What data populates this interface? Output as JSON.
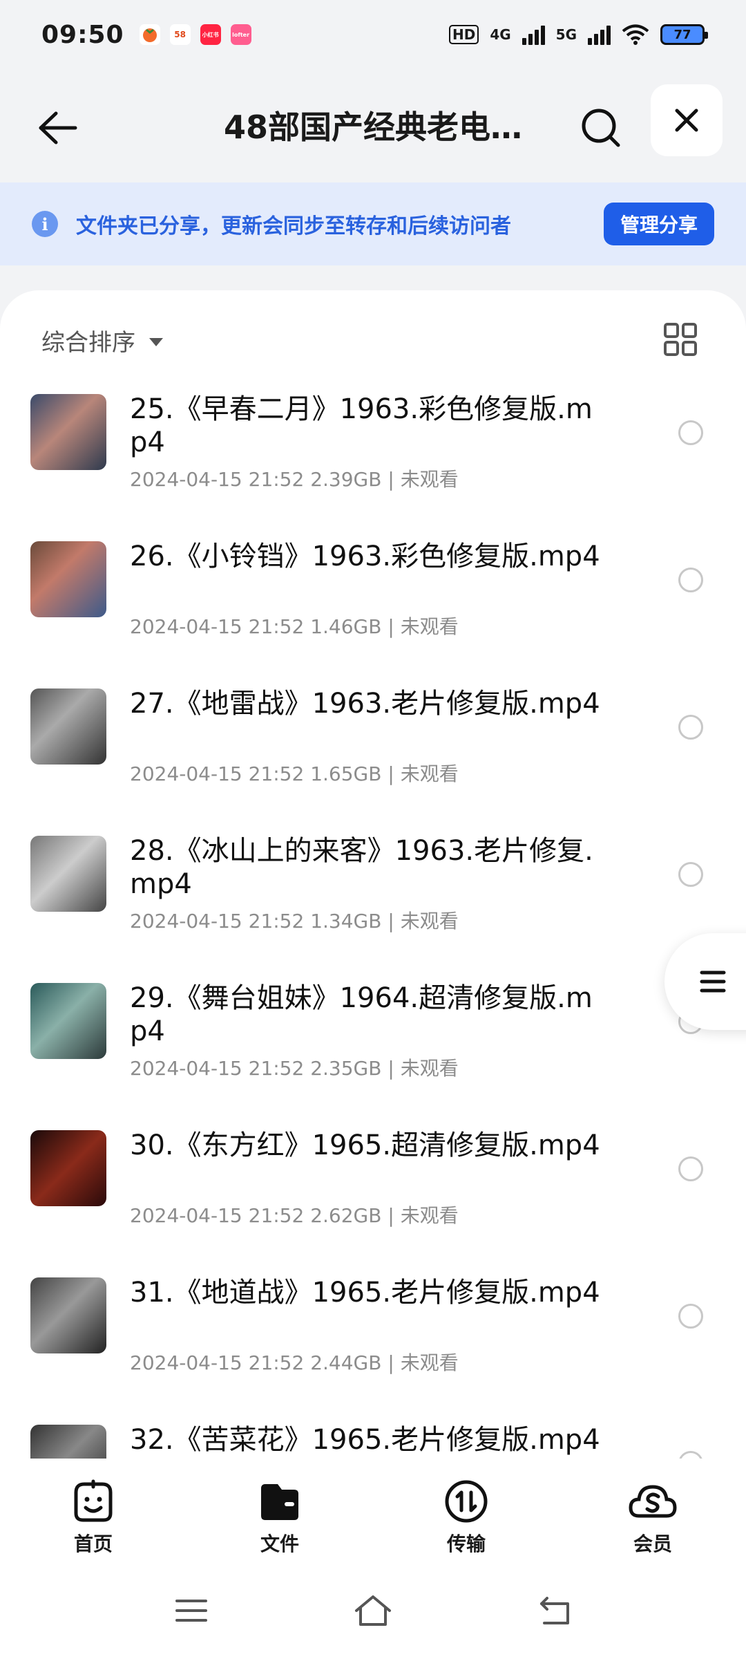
{
  "status_bar": {
    "time": "09:50",
    "notif_badges": [
      "58",
      "小红书",
      "lofter"
    ],
    "hd_label": "HD",
    "net_4g": "4G",
    "net_5g": "5G",
    "battery": "77"
  },
  "header": {
    "title": "48部国产经典老电…",
    "icons": [
      "back-arrow-icon",
      "search-icon",
      "close-icon"
    ]
  },
  "banner": {
    "text": "文件夹已分享，更新会同步至转存和后续访问者",
    "button": "管理分享",
    "accent": "#1f5ee8"
  },
  "toolbar": {
    "sort_label": "综合排序"
  },
  "files": [
    {
      "name": "25.《早春二月》1963.彩色修复版.mp4",
      "meta": "2024-04-15 21:52  2.39GB | 未观看"
    },
    {
      "name": "26.《小铃铛》1963.彩色修复版.mp4",
      "meta": "2024-04-15 21:52  1.46GB | 未观看"
    },
    {
      "name": "27.《地雷战》1963.老片修复版.mp4",
      "meta": "2024-04-15 21:52  1.65GB | 未观看"
    },
    {
      "name": "28.《冰山上的来客》1963.老片修复.mp4",
      "meta": "2024-04-15 21:52  1.34GB | 未观看"
    },
    {
      "name": "29.《舞台姐妹》1964.超清修复版.mp4",
      "meta": "2024-04-15 21:52  2.35GB | 未观看"
    },
    {
      "name": "30.《东方红》1965.超清修复版.mp4",
      "meta": "2024-04-15 21:52  2.62GB | 未观看"
    },
    {
      "name": "31.《地道战》1965.老片修复版.mp4",
      "meta": "2024-04-15 21:52  2.44GB | 未观看"
    },
    {
      "name": "32.《苦菜花》1965.老片修复版.mp4",
      "meta": ""
    }
  ],
  "bottom_nav": [
    {
      "label": "首页",
      "icon": "home-face-icon"
    },
    {
      "label": "文件",
      "icon": "folder-icon"
    },
    {
      "label": "传输",
      "icon": "transfer-icon"
    },
    {
      "label": "会员",
      "icon": "vip-cloud-icon"
    }
  ]
}
